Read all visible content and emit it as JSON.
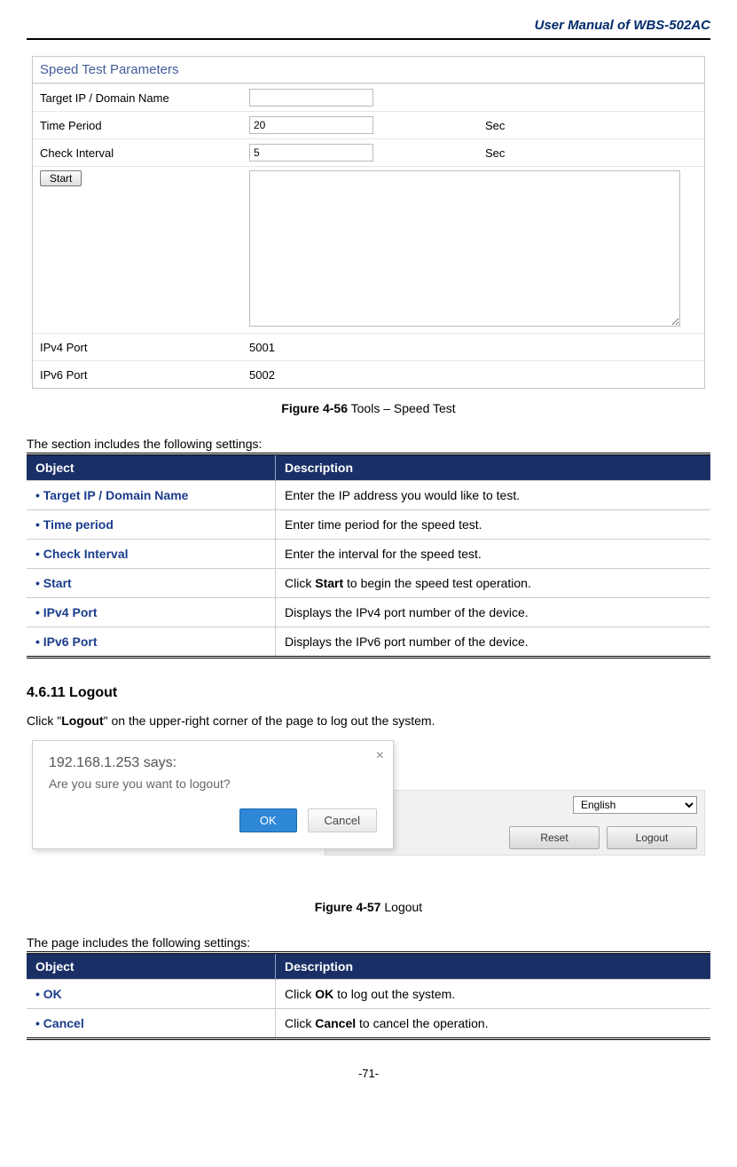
{
  "doc_title": "User  Manual  of  WBS-502AC",
  "speed_test": {
    "panel_title": "Speed Test Parameters",
    "rows": {
      "target_label": "Target IP / Domain Name",
      "target_value": "",
      "time_label": "Time Period",
      "time_value": "20",
      "time_unit": "Sec",
      "interval_label": "Check Interval",
      "interval_value": "5",
      "interval_unit": "Sec",
      "start_label": "Start",
      "ipv4_label": "IPv4 Port",
      "ipv4_value": "5001",
      "ipv6_label": "IPv6 Port",
      "ipv6_value": "5002"
    }
  },
  "fig56": {
    "bold": "Figure 4-56",
    "rest": " Tools – Speed Test"
  },
  "intro1": "The section includes the following settings:",
  "table_headers": {
    "obj": "Object",
    "desc": "Description"
  },
  "table1": [
    {
      "obj": "Target IP / Domain Name",
      "desc": "Enter the IP address you would like to test."
    },
    {
      "obj": "Time period",
      "desc": "Enter time period for the speed test."
    },
    {
      "obj": "Check Interval",
      "desc": "Enter the interval for the speed test."
    },
    {
      "obj": "Start",
      "desc_pre": "Click ",
      "desc_bold": "Start",
      "desc_post": " to begin the speed test operation."
    },
    {
      "obj": "IPv4 Port",
      "desc": "Displays the IPv4 port number of the device."
    },
    {
      "obj": "IPv6 Port",
      "desc": "Displays the IPv6 port number of the device."
    }
  ],
  "section_logout": {
    "heading": "4.6.11 Logout",
    "text_pre": "Click \"",
    "text_bold": "Logout",
    "text_post": "\" on the upper-right corner of the page to log out the system."
  },
  "dialog": {
    "title": "192.168.1.253 says:",
    "message": "Are you sure you want to logout?",
    "ok": "OK",
    "cancel": "Cancel",
    "close_glyph": "×"
  },
  "bg_ui": {
    "language": "English",
    "reset": "Reset",
    "logout": "Logout"
  },
  "fig57": {
    "bold": "Figure 4-57",
    "rest": " Logout"
  },
  "intro2": "The page includes the following settings:",
  "table2": [
    {
      "obj": "OK",
      "desc_pre": "Click ",
      "desc_bold": "OK",
      "desc_post": " to log out the system."
    },
    {
      "obj": "Cancel",
      "desc_pre": "Click ",
      "desc_bold": "Cancel",
      "desc_post": " to cancel the operation."
    }
  ],
  "page_number": "-71-"
}
